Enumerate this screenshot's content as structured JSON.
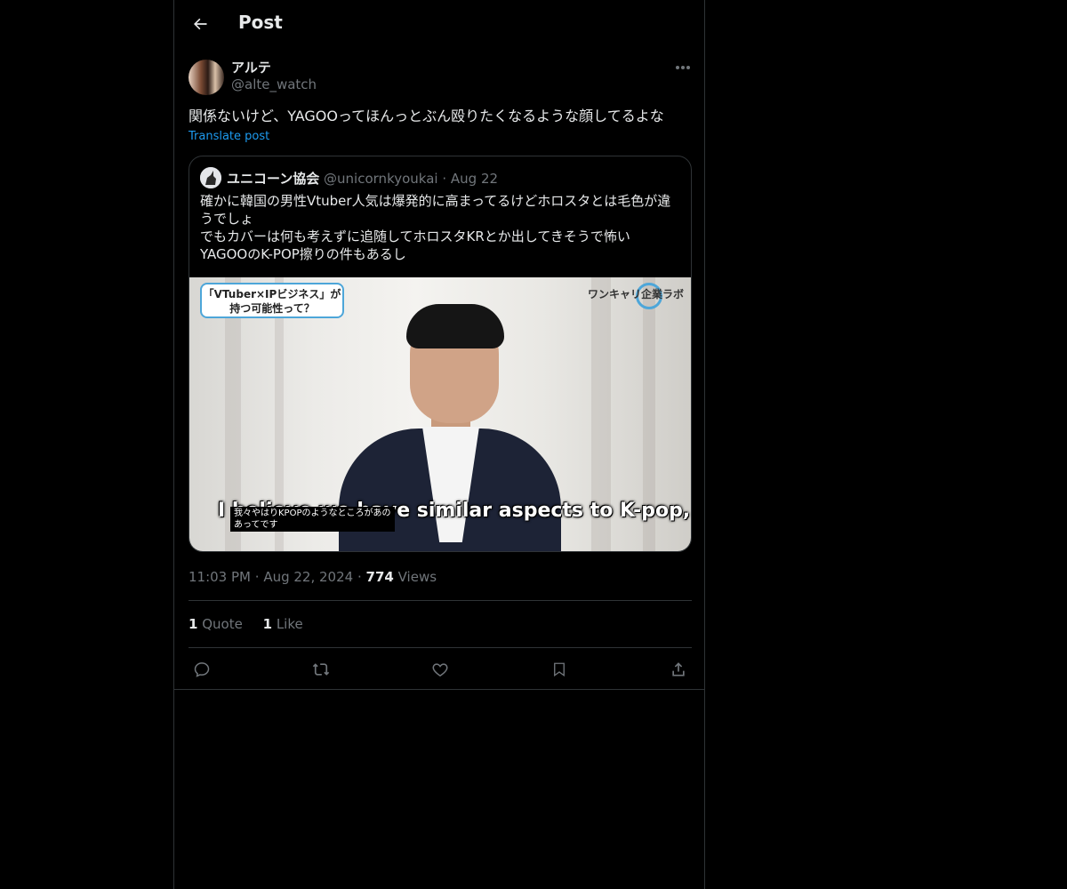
{
  "header": {
    "title": "Post"
  },
  "post": {
    "author_name": "アルテ",
    "author_handle": "@alte_watch",
    "text": "関係ないけど、YAGOOってほんっとぶん殴りたくなるような顔してるよな",
    "translate_label": "Translate post",
    "time": "11:03 PM",
    "date": "Aug 22, 2024",
    "views_count": "774",
    "views_label": "Views",
    "separator": "·"
  },
  "quoted_post": {
    "author_name": "ユニコーン協会",
    "author_handle": "@unicornkyoukai",
    "separator": "·",
    "date": "Aug 22",
    "lines": [
      "確かに韓国の男性Vtuber人気は爆発的に高まってるけどホロスタとは毛色が違うでしょ",
      "でもカバーは何も考えずに追随してホロスタKRとか出してきそうで怖い",
      "YAGOOのK-POP擦りの件もあるし"
    ],
    "media": {
      "caption_box_line1": "「VTuber×IPビジネス」が",
      "caption_box_line2": "持つ可能性って？",
      "logo_text": "ワンキャリ企業ラボ",
      "subtitle_en": "I believe we have similar aspects to K-pop,",
      "subtitle_jp_line1": "我々やはりKPOPのようなところがあの",
      "subtitle_jp_line2": "あってです"
    }
  },
  "stats": {
    "quote_count": "1",
    "quote_label": "Quote",
    "like_count": "1",
    "like_label": "Like"
  },
  "icons": {
    "back": "arrow-left-icon",
    "more": "more-horizontal-icon",
    "reply": "reply-icon",
    "repost": "repost-icon",
    "like": "heart-icon",
    "bookmark": "bookmark-icon",
    "share": "share-icon"
  },
  "colors": {
    "background": "#000000",
    "text_primary": "#e7e9ea",
    "text_secondary": "#71767b",
    "link": "#1d9bf0",
    "border": "#2f3336"
  }
}
